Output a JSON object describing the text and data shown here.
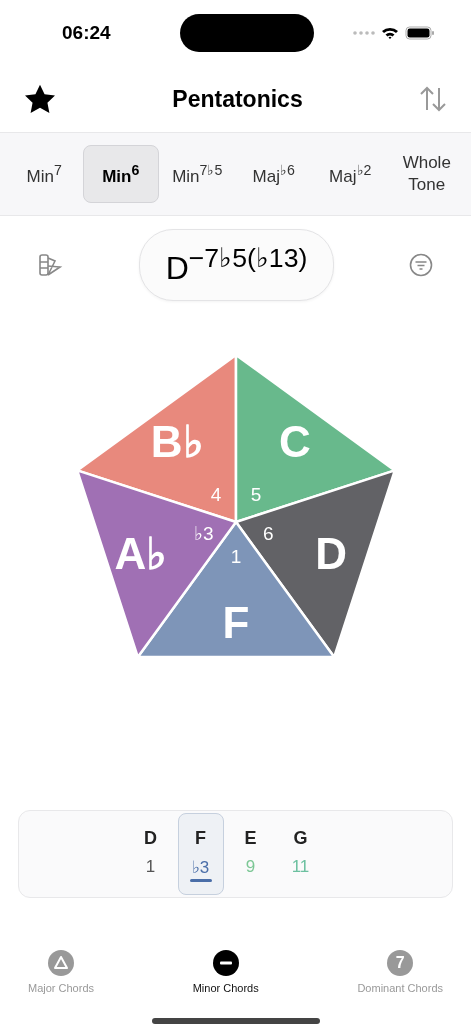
{
  "status_bar": {
    "time": "06:24"
  },
  "nav": {
    "title": "Pentatonics"
  },
  "scale_tabs": [
    {
      "label": "Min$^{7}$",
      "selected": false
    },
    {
      "label": "Min$^{6}$",
      "selected": true
    },
    {
      "label": "Min$^{7♭5}$",
      "selected": false
    },
    {
      "label": "Maj$^{♭6}$",
      "selected": false
    },
    {
      "label": "Maj$^{♭2}$",
      "selected": false
    },
    {
      "label": "Whole Tone",
      "selected": false
    }
  ],
  "chord_symbol": "D$^{−7♭5(♭13)}$",
  "pentagon": [
    {
      "note": "B♭",
      "degree": "4",
      "color": "#e8897d"
    },
    {
      "note": "C",
      "degree": "5",
      "color": "#68b98c"
    },
    {
      "note": "D",
      "degree": "6",
      "color": "#626266"
    },
    {
      "note": "F",
      "degree": "1",
      "color": "#7e95b8"
    },
    {
      "note": "A♭",
      "degree": "♭3",
      "color": "#a070b4"
    }
  ],
  "note_strip": [
    {
      "note": "D",
      "degree": "1",
      "color": "#555555",
      "selected": false
    },
    {
      "note": "F",
      "degree": "♭3",
      "color": "#4a6ea8",
      "selected": true
    },
    {
      "note": "E",
      "degree": "9",
      "color": "#7cc795",
      "selected": false
    },
    {
      "note": "G",
      "degree": "11",
      "color": "#6cc0a0",
      "selected": false
    }
  ],
  "bottom_tabs": [
    {
      "label": "Major Chords",
      "kind": "triangle",
      "selected": false
    },
    {
      "label": "Minor Chords",
      "kind": "minus",
      "selected": true
    },
    {
      "label": "Dominant Chords",
      "kind": "number",
      "badge": "7",
      "selected": false
    }
  ]
}
